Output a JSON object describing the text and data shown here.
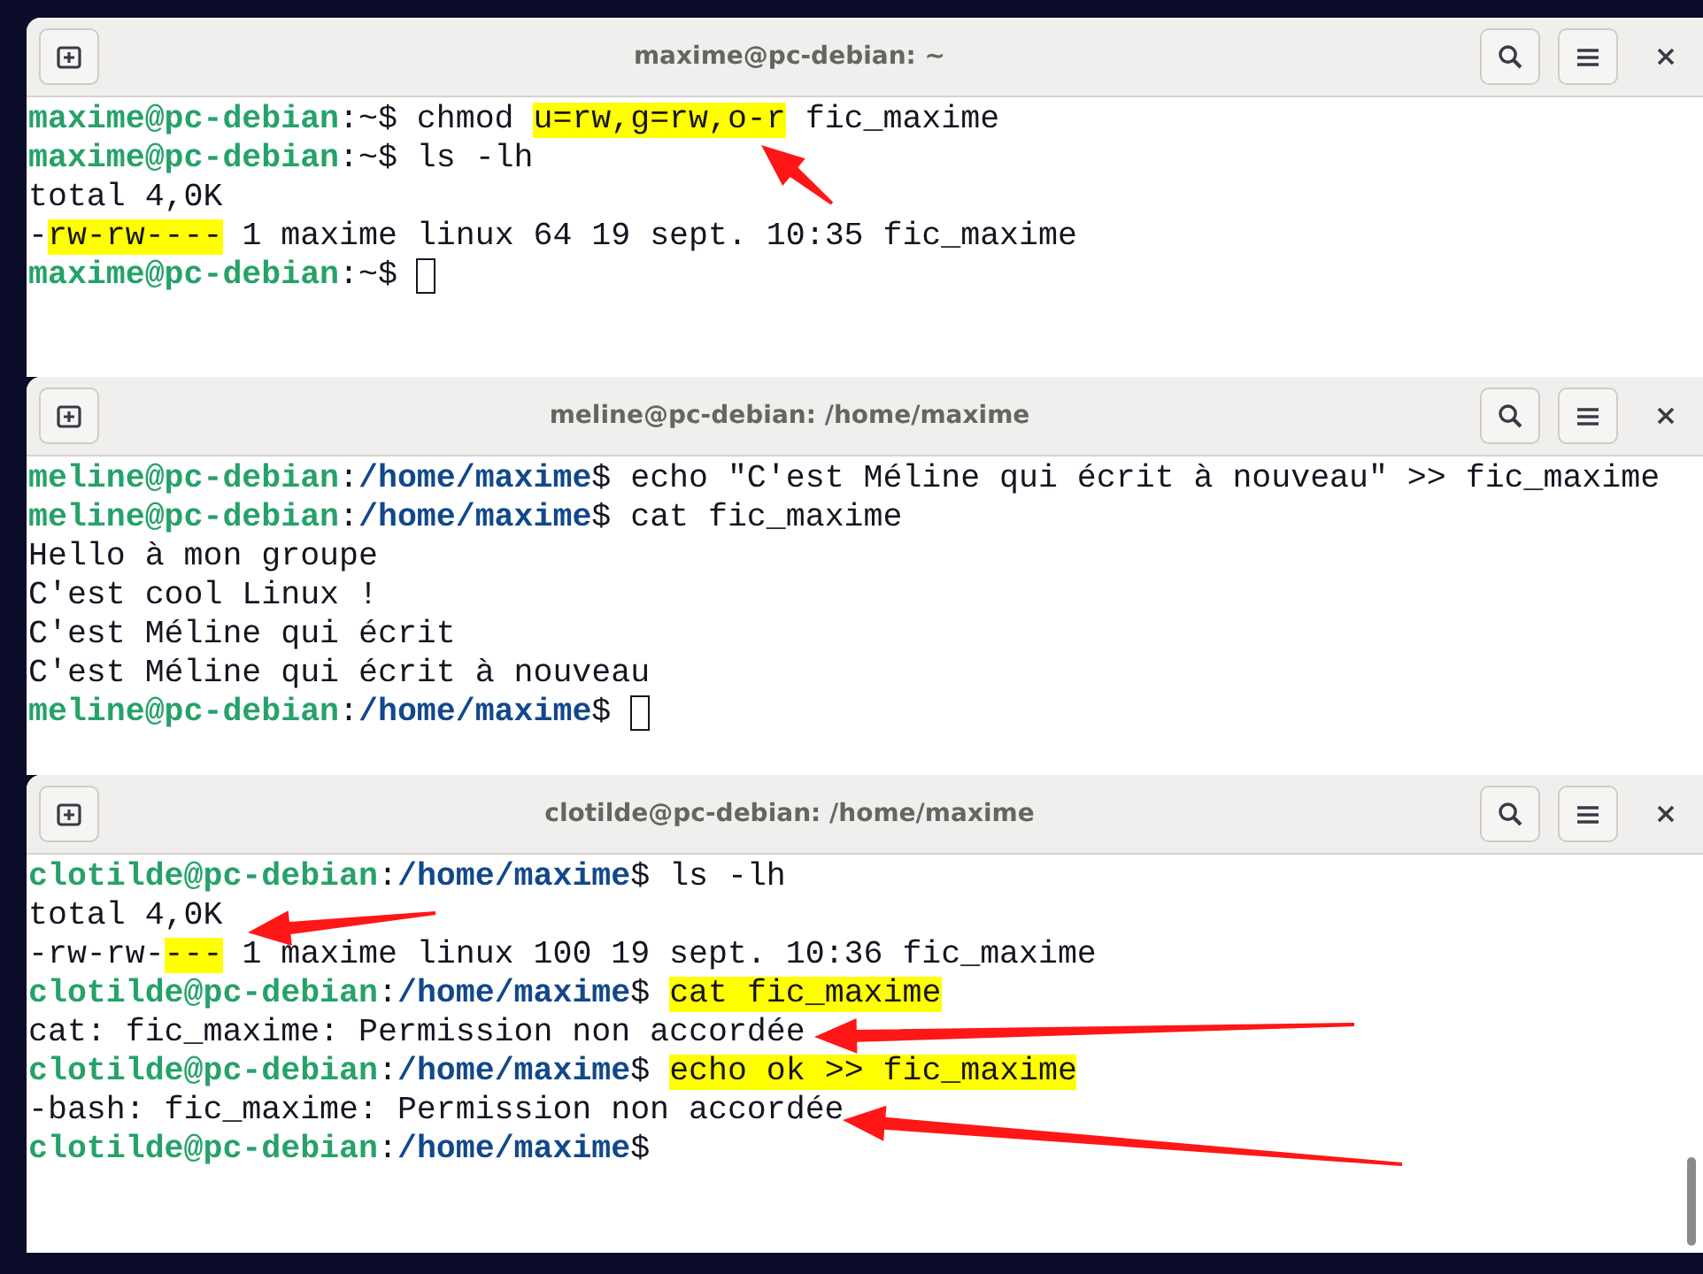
{
  "windows": [
    {
      "title": "maxime@pc-debian: ~",
      "lines": [
        [
          {
            "kind": "user",
            "text": "maxime@pc-debian"
          },
          {
            "kind": "text",
            "text": ":~$ chmod "
          },
          {
            "kind": "marked",
            "text": "u=rw,g=rw,o-r"
          },
          {
            "kind": "text",
            "text": " fic_maxime"
          }
        ],
        [
          {
            "kind": "user",
            "text": "maxime@pc-debian"
          },
          {
            "kind": "text",
            "text": ":~$ ls -lh"
          }
        ],
        [
          {
            "kind": "text",
            "text": "total 4,0K"
          }
        ],
        [
          {
            "kind": "text",
            "text": "-"
          },
          {
            "kind": "marked",
            "text": "rw-rw----"
          },
          {
            "kind": "text",
            "text": " 1 maxime linux 64 19 sept. 10:35 fic_maxime"
          }
        ],
        [
          {
            "kind": "user",
            "text": "maxime@pc-debian"
          },
          {
            "kind": "text",
            "text": ":~$ "
          },
          {
            "kind": "cursor"
          }
        ]
      ]
    },
    {
      "title": "meline@pc-debian: /home/maxime",
      "lines": [
        [
          {
            "kind": "user",
            "text": "meline@pc-debian"
          },
          {
            "kind": "text",
            "text": ":"
          },
          {
            "kind": "path",
            "text": "/home/maxime"
          },
          {
            "kind": "text",
            "text": "$ echo \"C'est Méline qui écrit à nouveau\" >> fic_maxime"
          }
        ],
        [
          {
            "kind": "user",
            "text": "meline@pc-debian"
          },
          {
            "kind": "text",
            "text": ":"
          },
          {
            "kind": "path",
            "text": "/home/maxime"
          },
          {
            "kind": "text",
            "text": "$ cat fic_maxime"
          }
        ],
        [
          {
            "kind": "text",
            "text": "Hello à mon groupe"
          }
        ],
        [
          {
            "kind": "text",
            "text": "C'est cool Linux !"
          }
        ],
        [
          {
            "kind": "text",
            "text": "C'est Méline qui écrit"
          }
        ],
        [
          {
            "kind": "text",
            "text": "C'est Méline qui écrit à nouveau"
          }
        ],
        [
          {
            "kind": "user",
            "text": "meline@pc-debian"
          },
          {
            "kind": "text",
            "text": ":"
          },
          {
            "kind": "path",
            "text": "/home/maxime"
          },
          {
            "kind": "text",
            "text": "$ "
          },
          {
            "kind": "cursor"
          }
        ]
      ]
    },
    {
      "title": "clotilde@pc-debian: /home/maxime",
      "lines": [
        [
          {
            "kind": "user",
            "text": "clotilde@pc-debian"
          },
          {
            "kind": "text",
            "text": ":"
          },
          {
            "kind": "path",
            "text": "/home/maxime"
          },
          {
            "kind": "text",
            "text": "$ ls -lh"
          }
        ],
        [
          {
            "kind": "text",
            "text": "total 4,0K"
          }
        ],
        [
          {
            "kind": "text",
            "text": "-rw-rw-"
          },
          {
            "kind": "marked",
            "text": "---"
          },
          {
            "kind": "text",
            "text": " 1 maxime linux 100 19 sept. 10:36 fic_maxime"
          }
        ],
        [
          {
            "kind": "user",
            "text": "clotilde@pc-debian"
          },
          {
            "kind": "text",
            "text": ":"
          },
          {
            "kind": "path",
            "text": "/home/maxime"
          },
          {
            "kind": "text",
            "text": "$ "
          },
          {
            "kind": "marked",
            "text": "cat fic_maxime"
          }
        ],
        [
          {
            "kind": "text",
            "text": "cat: fic_maxime: Permission non accordée"
          }
        ],
        [
          {
            "kind": "user",
            "text": "clotilde@pc-debian"
          },
          {
            "kind": "text",
            "text": ":"
          },
          {
            "kind": "path",
            "text": "/home/maxime"
          },
          {
            "kind": "text",
            "text": "$ "
          },
          {
            "kind": "marked",
            "text": "echo ok >> fic_maxime"
          }
        ],
        [
          {
            "kind": "text",
            "text": "-bash: fic_maxime: Permission non accordée"
          }
        ],
        [
          {
            "kind": "user",
            "text": "clotilde@pc-debian"
          },
          {
            "kind": "text",
            "text": ":"
          },
          {
            "kind": "path",
            "text": "/home/maxime"
          },
          {
            "kind": "text",
            "text": "$"
          }
        ]
      ]
    }
  ]
}
